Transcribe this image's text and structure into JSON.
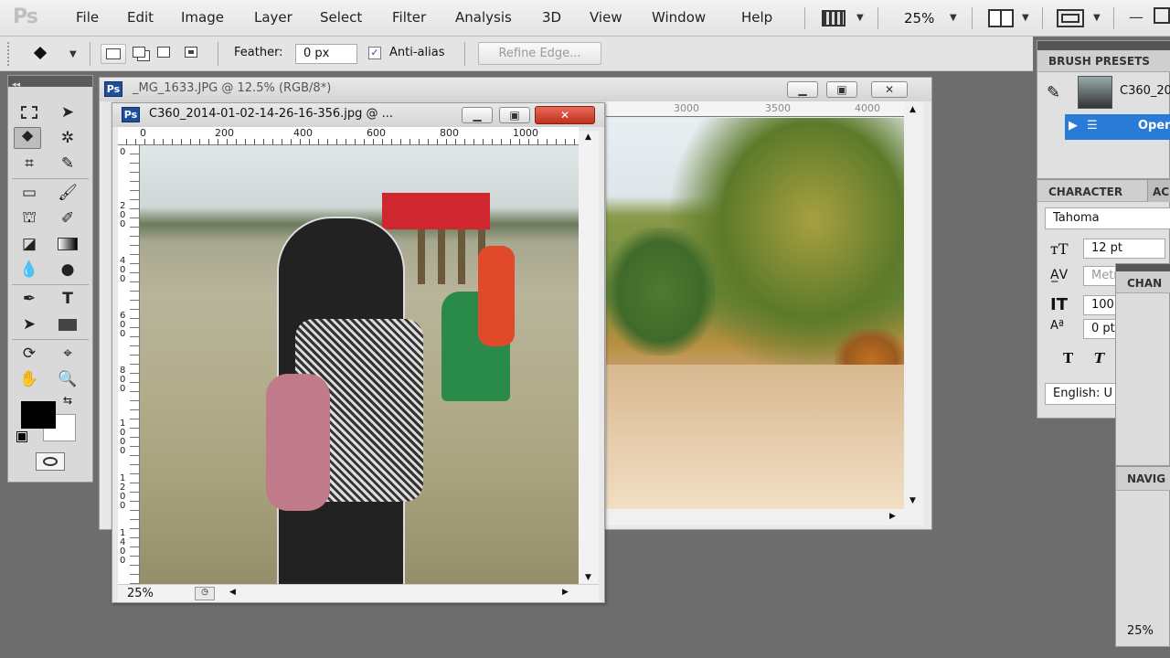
{
  "app": {
    "logo": "Ps"
  },
  "menu": [
    "File",
    "Edit",
    "Image",
    "Layer",
    "Select",
    "Filter",
    "Analysis",
    "3D",
    "View",
    "Window",
    "Help"
  ],
  "appbar": {
    "zoom": "25%"
  },
  "options": {
    "feather_label": "Feather:",
    "feather_value": "0 px",
    "antialias_label": "Anti-alias",
    "refine_edge": "Refine Edge..."
  },
  "back_doc": {
    "title": "_MG_1633.JPG @ 12.5% (RGB/8*)",
    "ruler": [
      "3000",
      "3500",
      "4000"
    ]
  },
  "front_doc": {
    "title": "C360_2014-01-02-14-26-16-356.jpg @ ...",
    "ruler_h": [
      "0",
      "200",
      "400",
      "600",
      "800",
      "1000"
    ],
    "ruler_v": [
      "0",
      "200",
      "400",
      "600",
      "800",
      "1000",
      "1200",
      "1400"
    ],
    "zoom": "25%"
  },
  "panels": {
    "brush_presets": {
      "tab": "BRUSH PRESETS",
      "item": "C360_20",
      "open": "Open"
    },
    "character": {
      "tab": "CHARACTER",
      "tab2": "AC",
      "font": "Tahoma",
      "size": "12 pt",
      "kerning": "Metr",
      "vscale": "100",
      "baseline": "0 pt",
      "language": "English: U"
    },
    "channels": {
      "tab": "CHAN"
    },
    "navigator": {
      "tab": "NAVIG",
      "zoom": "25%"
    }
  },
  "colors": {
    "foreground": "#000000",
    "background": "#ffffff",
    "accent": "#1f4f9c"
  }
}
